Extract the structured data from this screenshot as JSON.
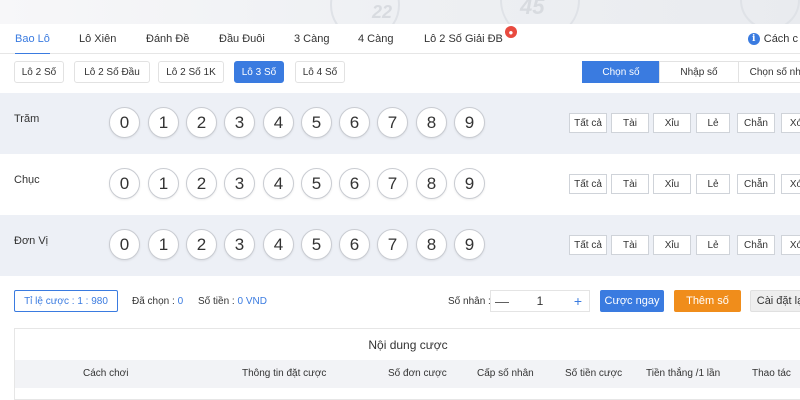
{
  "tabs": [
    {
      "label": "Bao Lô",
      "active": true
    },
    {
      "label": "Lô Xiên"
    },
    {
      "label": "Đánh Đề"
    },
    {
      "label": "Đầu Đuôi"
    },
    {
      "label": "3 Càng"
    },
    {
      "label": "4 Càng"
    },
    {
      "label": "Lô 2 Số Giải ĐB",
      "hot": true
    }
  ],
  "howto_label": "Cách c",
  "sub_tabs": [
    {
      "label": "Lô 2 Số"
    },
    {
      "label": "Lô 2 Số Đầu"
    },
    {
      "label": "Lô 2 Số 1K"
    },
    {
      "label": "Lô 3 Số",
      "active": true
    },
    {
      "label": "Lô 4 Số"
    }
  ],
  "input_modes": [
    {
      "label": "Chọn số",
      "active": true
    },
    {
      "label": "Nhập số"
    },
    {
      "label": "Chọn số nha"
    }
  ],
  "digit_rows": [
    {
      "label": "Trăm"
    },
    {
      "label": "Chục"
    },
    {
      "label": "Đơn Vị"
    }
  ],
  "digits": [
    "0",
    "1",
    "2",
    "3",
    "4",
    "5",
    "6",
    "7",
    "8",
    "9"
  ],
  "filters": [
    "Tất cả",
    "Tài",
    "Xỉu",
    "Lẻ",
    "Chẵn",
    "Xó"
  ],
  "bet": {
    "ratio_label": "Tỉ lệ cược :",
    "ratio_value": "1 : 980",
    "selected_label": "Đã chọn :",
    "selected_value": "0",
    "amount_label": "Số tiền :",
    "amount_value": "0 VND",
    "multiplier_label": "Số nhân :",
    "multiplier_value": "1",
    "bet_now": "Cược ngay",
    "add_number": "Thêm số",
    "reset": "Cài đặt lạ"
  },
  "table": {
    "title": "Nội dung cược",
    "columns": [
      "Cách chơi",
      "Thông tin đặt cược",
      "Số đơn cược",
      "Cấp số nhân",
      "Số tiền cược",
      "Tiền thắng /1 lần",
      "Thao tác"
    ]
  },
  "decor": {
    "numbers": [
      "22",
      "45"
    ]
  },
  "colors": {
    "accent": "#3a7be0",
    "orange": "#f08d1b",
    "hot": "#e84a3f",
    "row_shade": "#edf0f6"
  }
}
